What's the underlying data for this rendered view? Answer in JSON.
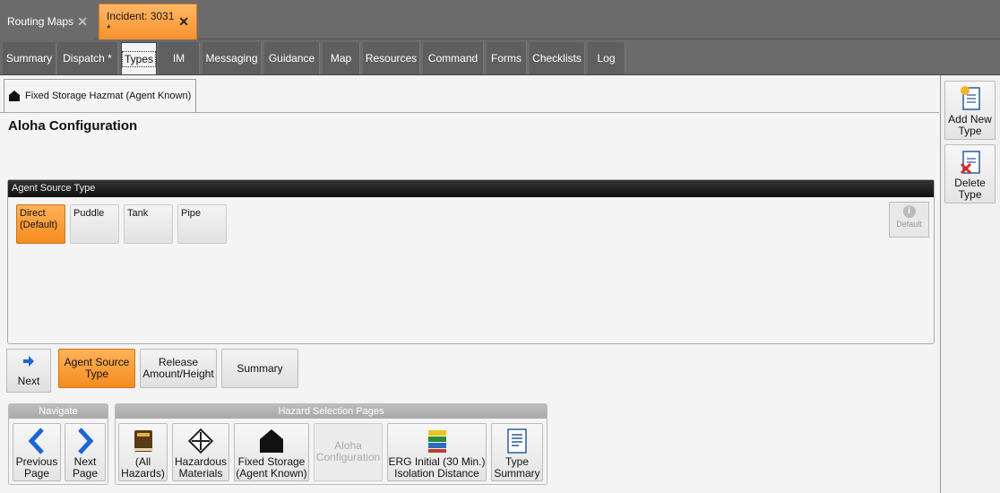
{
  "doc_tabs": [
    {
      "label": "Routing Maps",
      "close": "✕"
    },
    {
      "label": "Incident: 3031 *",
      "close": "✕"
    }
  ],
  "nav_tabs": [
    "Summary",
    "Dispatch *",
    "Types",
    "IM",
    "Messaging",
    "Guidance",
    "Map",
    "Resources",
    "Command",
    "Forms",
    "Checklists",
    "Log"
  ],
  "active_nav": "Types",
  "sub_tab": {
    "label": "Fixed Storage Hazmat (Agent Known)"
  },
  "page_title": "Aloha Configuration",
  "agent_source": {
    "title": "Agent Source Type",
    "options": [
      {
        "label": "Direct (Default)",
        "selected": true
      },
      {
        "label": "Puddle",
        "selected": false
      },
      {
        "label": "Tank",
        "selected": false
      },
      {
        "label": "Pipe",
        "selected": false
      }
    ],
    "default_label": "Default",
    "default_icon": "info-icon"
  },
  "wizard": {
    "next_label": "Next",
    "steps": [
      {
        "label": "Agent Source Type",
        "selected": true
      },
      {
        "label": "Release Amount/Height",
        "selected": false
      },
      {
        "label": "Summary",
        "selected": false
      }
    ]
  },
  "navigate": {
    "title": "Navigate",
    "previous": "Previous Page",
    "next": "Next Page"
  },
  "hazard": {
    "title": "Hazard Selection Pages",
    "pages": [
      {
        "label": "(All Hazards)",
        "icon": "book-icon",
        "enabled": true
      },
      {
        "label": "Hazardous Materials",
        "icon": "hazmat-icon",
        "enabled": true
      },
      {
        "label": "Fixed Storage (Agent Known)",
        "icon": "house-icon",
        "enabled": true
      },
      {
        "label": "Aloha Configuration",
        "icon": "",
        "enabled": false
      },
      {
        "label": "ERG Initial (30 Min.) Isolation Distance",
        "icon": "books-icon",
        "enabled": true
      },
      {
        "label": "Type Summary",
        "icon": "summary-doc-icon",
        "enabled": true
      }
    ]
  },
  "side": {
    "add": "Add New Type",
    "delete": "Delete Type"
  },
  "colors": {
    "accent": "#f7922c",
    "chrome": "#6b6b6b",
    "nav_blue": "#1a66d6"
  }
}
